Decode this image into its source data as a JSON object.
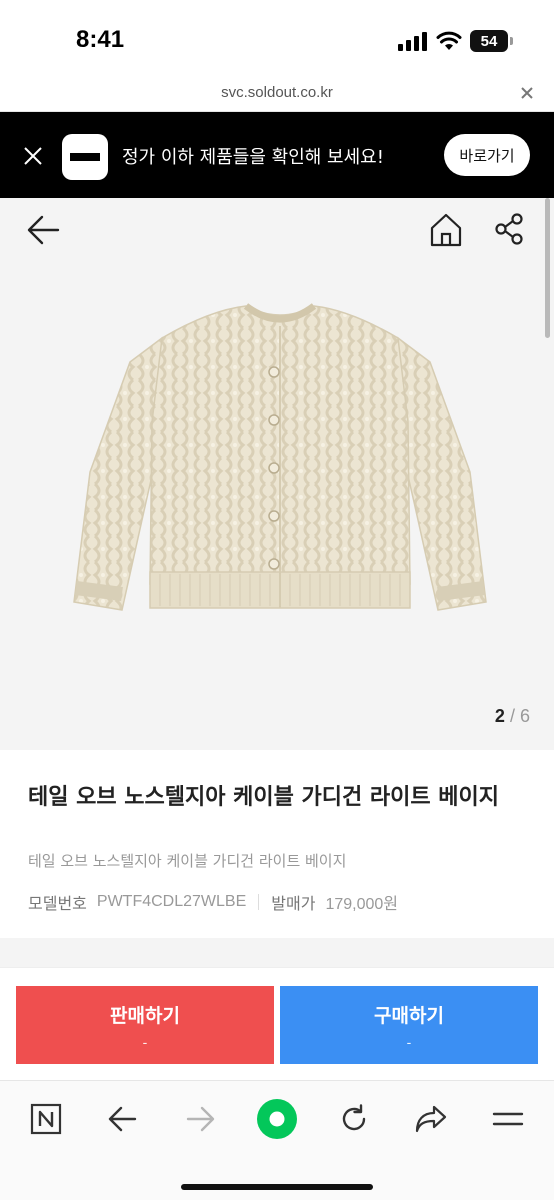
{
  "status_bar": {
    "time": "8:41",
    "battery": "54"
  },
  "url_bar": {
    "url": "svc.soldout.co.kr"
  },
  "promo": {
    "text": "정가 이하 제품들을 확인해 보세요!",
    "button_label": "바로가기"
  },
  "gallery": {
    "current": "2",
    "separator": "/",
    "total": "6"
  },
  "product": {
    "title": "테일 오브 노스텔지아 케이블 가디건 라이트 베이지",
    "subtitle": "테일 오브 노스텔지아 케이블 가디건 라이트 베이지",
    "model_label": "모델번호",
    "model_number": "PWTF4CDL27WLBE",
    "release_price_label": "발매가",
    "release_price": "179,000원"
  },
  "actions": {
    "sell_label": "판매하기",
    "sell_price": "-",
    "buy_label": "구매하기",
    "buy_price": "-"
  },
  "colors": {
    "sell": "#ef4f4f",
    "buy": "#3b8ff3",
    "naver_green": "#03c75a",
    "cardigan": "#ece5d2"
  },
  "icons": {
    "back": "arrow-left-icon",
    "home": "home-icon",
    "share": "share-icon",
    "toolbar": [
      "naver-n-icon",
      "back-arrow-icon",
      "forward-arrow-icon",
      "naver-green-dot-icon",
      "reload-icon",
      "share-arrow-icon",
      "menu-icon"
    ]
  }
}
